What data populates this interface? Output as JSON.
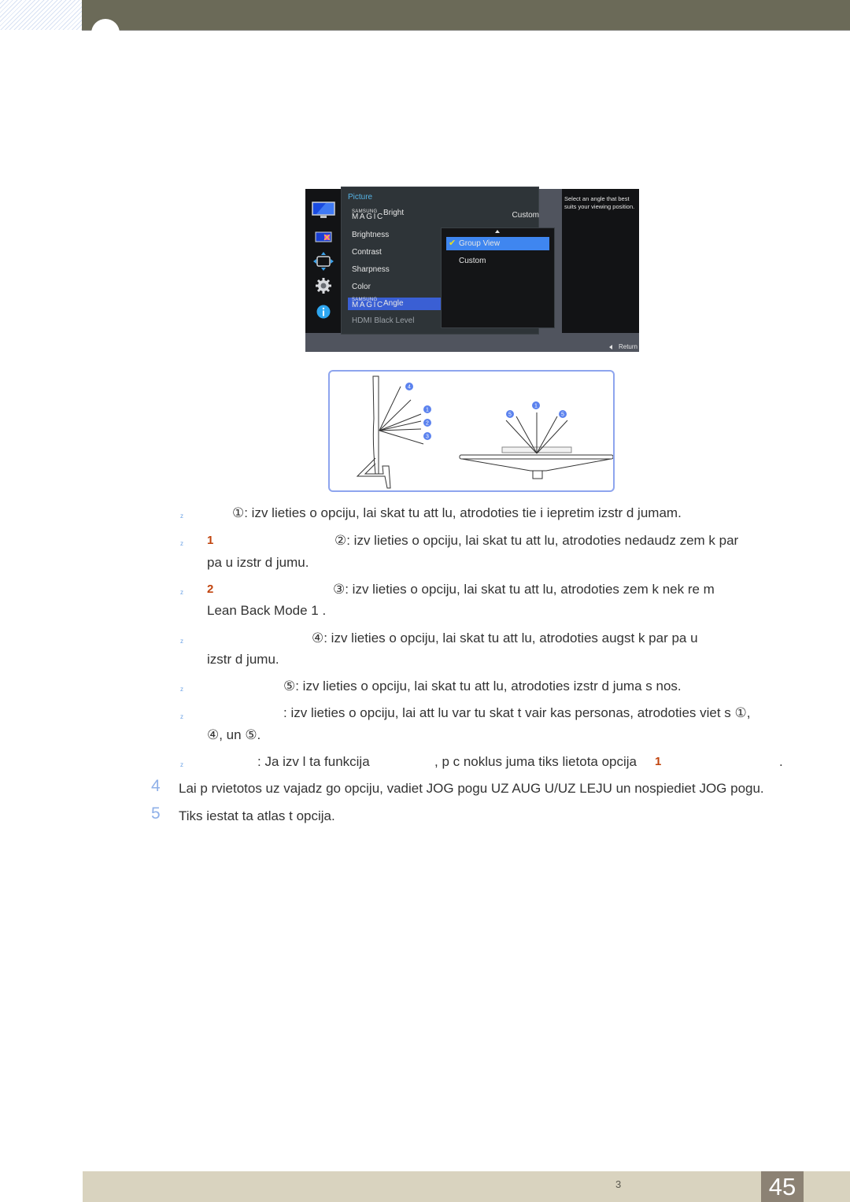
{
  "header": {
    "chapter_marker": ""
  },
  "osd": {
    "section_title": "Picture",
    "brand_small": "SAMSUNG",
    "brand_large": "MAGIC",
    "menu_items": [
      {
        "suffix": "Bright",
        "value": "Custom",
        "magic": true
      },
      {
        "label": "Brightness"
      },
      {
        "label": "Contrast"
      },
      {
        "label": "Sharpness"
      },
      {
        "label": "Color"
      },
      {
        "suffix": "Angle",
        "magic": true,
        "selected": true
      },
      {
        "label": "HDMI Black Level",
        "disabled": true
      }
    ],
    "submenu": [
      {
        "label": "Group View",
        "selected": true
      },
      {
        "label": "Custom"
      }
    ],
    "help_text": "Select an angle that best suits your viewing position.",
    "return_label": "Return",
    "side_icons": [
      "picture-icon",
      "onscreen-display-icon",
      "position-icon",
      "settings-gear-icon",
      "info-icon"
    ]
  },
  "diagram": {
    "side_view_labels": [
      "4",
      "1",
      "2",
      "3"
    ],
    "top_view_labels": [
      "5",
      "1",
      "5"
    ]
  },
  "bullets": [
    {
      "text": "①: izv lieties  o opciju, lai skat tu att lu, atrodoties tie i iepretim izstr d jumam."
    },
    {
      "red": "1",
      "text": "②: izv lieties  o opciju, lai skat tu att lu, atrodoties nedaudz zem k par",
      "cont": "pa u izstr d jumu."
    },
    {
      "red": "2",
      "text": "③: izv lieties  o opciju, lai skat tu att lu, atrodoties zem k nek  re  m",
      "cont": "Lean Back Mode 1 ."
    },
    {
      "text": "④: izv lieties  o opciju, lai skat tu att lu, atrodoties augst k par pa u",
      "cont": "izstr d jumu."
    },
    {
      "text": "⑤: izv lieties  o opciju, lai skat tu att lu, atrodoties izstr d juma s nos."
    },
    {
      "text": ": izv lieties  o opciju, lai att lu var tu skat t vair kas personas, atrodoties viet s  ①,",
      "cont": "④, un ⑤."
    },
    {
      "text_a": ": Ja izv l ta funkcija",
      "text_b": ", p c noklus juma tiks lietota opcija",
      "red": "1",
      "text_c": "."
    }
  ],
  "steps": [
    {
      "num": "4",
      "text": "Lai p rvietotos uz vajadz go opciju, vadiet JOG pogu UZ AUG U/UZ LEJU un nospiediet JOG pogu."
    },
    {
      "num": "5",
      "text": "Tiks iestat ta atlas t  opcija."
    }
  ],
  "footer": {
    "chapter_num": "3",
    "page_number": "45"
  }
}
